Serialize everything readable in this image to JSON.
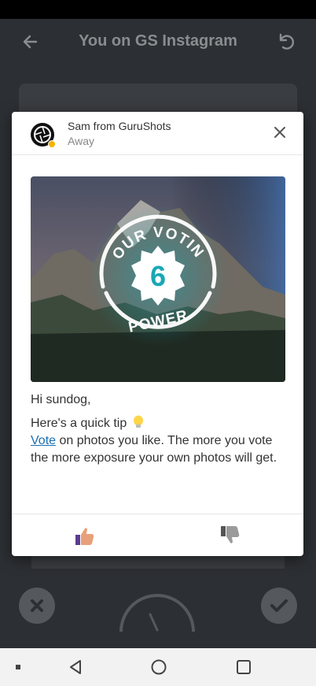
{
  "appbar": {
    "title": "You on GS Instagram"
  },
  "dialog": {
    "sender": "Sam from GuruShots",
    "status": "Away",
    "banner": {
      "arc_text": "YOUR VOTING",
      "power_text": "POWER",
      "power_value": "6"
    },
    "greeting": "Hi sundog,",
    "tip_intro": "Here's a quick tip",
    "tip_link": "Vote",
    "tip_text": " on photos you like. The more you vote the more exposure your own photos will get."
  },
  "icons": {
    "back": "back-arrow-icon",
    "undo": "undo-icon",
    "close": "close-icon",
    "bulb": "light-bulb-icon",
    "like": "thumbs-up-icon",
    "dislike": "thumbs-down-icon",
    "reject": "x-circle-icon",
    "accept": "check-circle-icon"
  },
  "colors": {
    "link": "#1a6fb3",
    "badge_teal": "#1aa7b5",
    "away_dot": "#f5b400"
  }
}
